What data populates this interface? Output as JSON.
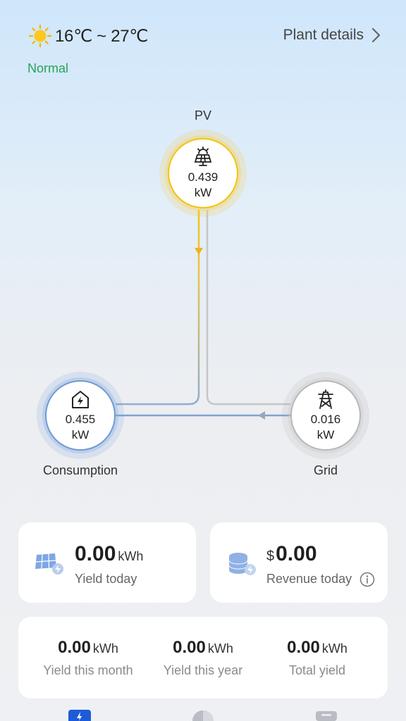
{
  "header": {
    "weather_icon": "sun-icon",
    "temperature": "16℃ ~ 27℃",
    "status": "Normal",
    "plant_details_label": "Plant details",
    "chevron_icon": "chevron-right-icon"
  },
  "flow": {
    "pv": {
      "label": "PV",
      "value": "0.439",
      "unit": "kW",
      "icon": "solar-panel-icon"
    },
    "consumption": {
      "label": "Consumption",
      "value": "0.455",
      "unit": "kW",
      "icon": "home-power-icon"
    },
    "grid": {
      "label": "Grid",
      "value": "0.016",
      "unit": "kW",
      "icon": "power-tower-icon"
    }
  },
  "cards": {
    "yield_today": {
      "value": "0.00",
      "unit": "kWh",
      "label": "Yield today",
      "icon": "solar-yield-icon"
    },
    "revenue_today": {
      "currency": "$",
      "value": "0.00",
      "label": "Revenue today",
      "icon": "coins-icon",
      "info_icon": "info-icon"
    }
  },
  "stats": [
    {
      "value": "0.00",
      "unit": "kWh",
      "label": "Yield this month"
    },
    {
      "value": "0.00",
      "unit": "kWh",
      "label": "Yield this year"
    },
    {
      "value": "0.00",
      "unit": "kWh",
      "label": "Total yield"
    }
  ],
  "colors": {
    "status": "#27a35a",
    "pv_accent": "#f1c40f",
    "consumption_accent": "#6f9ad6",
    "grid_accent": "#b8b8b8",
    "tab_active": "#1e5bd8"
  },
  "tabs": {
    "icons": [
      "flash-tab-icon",
      "pie-chart-tab-icon",
      "device-tab-icon"
    ]
  }
}
